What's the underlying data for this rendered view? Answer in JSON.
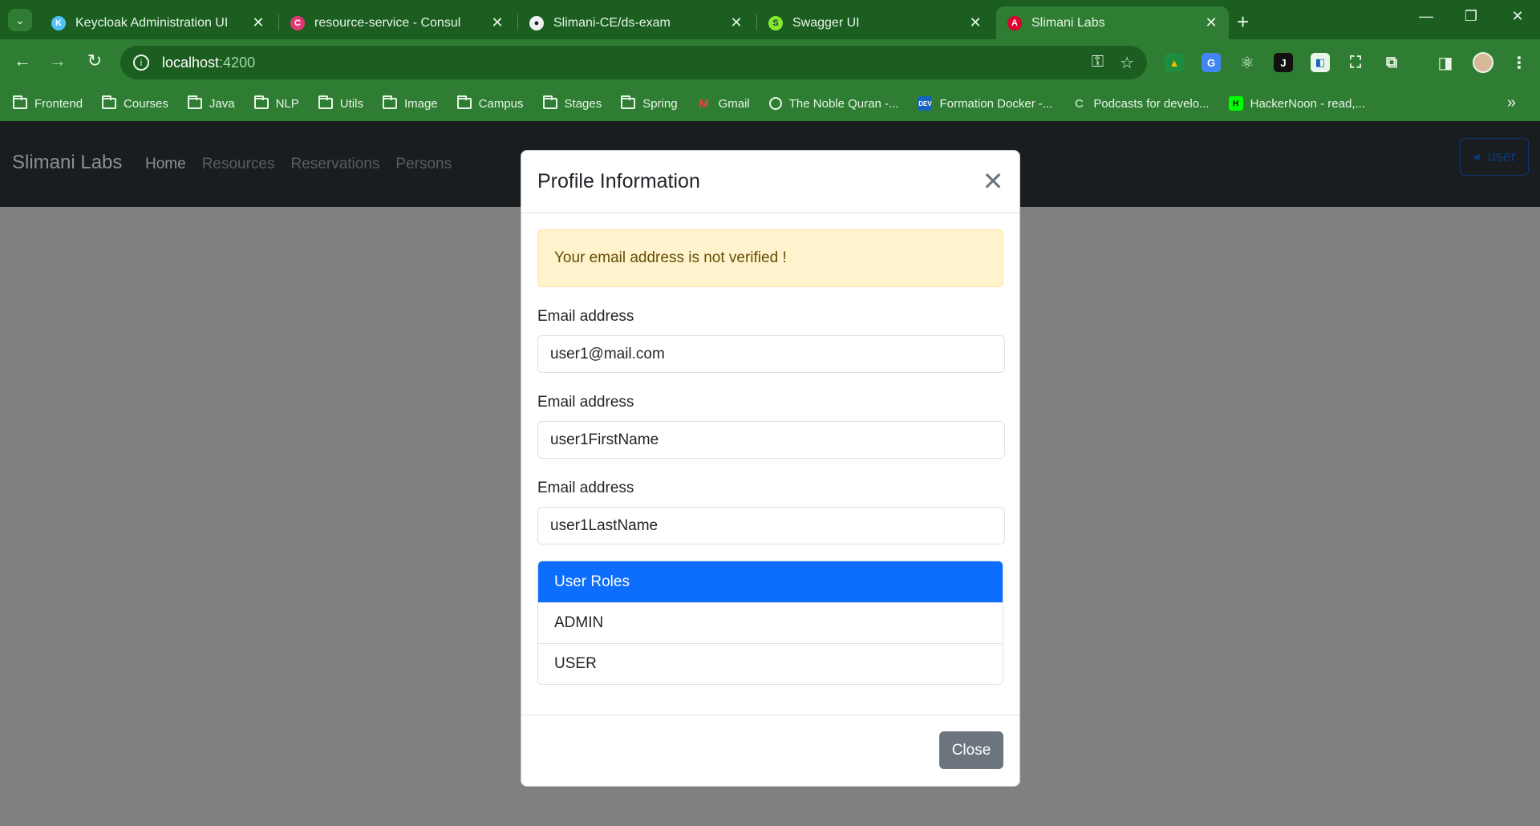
{
  "browser": {
    "tabs": [
      {
        "title": "Keycloak Administration UI",
        "active": false
      },
      {
        "title": "resource-service - Consul",
        "active": false
      },
      {
        "title": "Slimani-CE/ds-exam",
        "active": false
      },
      {
        "title": "Swagger UI",
        "active": false
      },
      {
        "title": "Slimani Labs",
        "active": true
      }
    ],
    "new_tab": "+",
    "window_controls": {
      "minimize": "—",
      "restore": "❐",
      "close": "✕"
    },
    "address": {
      "host": "localhost",
      "port": ":4200"
    },
    "bookmarks": [
      {
        "label": "Frontend",
        "type": "folder"
      },
      {
        "label": "Courses",
        "type": "folder"
      },
      {
        "label": "Java",
        "type": "folder"
      },
      {
        "label": "NLP",
        "type": "folder"
      },
      {
        "label": "Utils",
        "type": "folder"
      },
      {
        "label": "Image",
        "type": "folder"
      },
      {
        "label": "Campus",
        "type": "folder"
      },
      {
        "label": "Stages",
        "type": "folder"
      },
      {
        "label": "Spring",
        "type": "folder"
      },
      {
        "label": "Gmail",
        "type": "site",
        "icon": "gmail-icon"
      },
      {
        "label": "The Noble Quran -...",
        "type": "site",
        "icon": "quran-icon"
      },
      {
        "label": "Formation Docker -...",
        "type": "site",
        "icon": "dev-icon"
      },
      {
        "label": "Podcasts for develo...",
        "type": "site",
        "icon": "podcast-icon"
      },
      {
        "label": "HackerNoon - read,...",
        "type": "site",
        "icon": "hackernoon-icon"
      }
    ]
  },
  "app": {
    "brand": "Slimani Labs",
    "nav": [
      {
        "label": "Home",
        "active": true
      },
      {
        "label": "Resources",
        "active": false
      },
      {
        "label": "Reservations",
        "active": false
      },
      {
        "label": "Persons",
        "active": false
      }
    ],
    "user_button": "user"
  },
  "modal": {
    "title": "Profile Information",
    "alert": "Your email address is not verified !",
    "fields": [
      {
        "label": "Email address",
        "value": "user1@mail.com"
      },
      {
        "label": "Email address",
        "value": "user1FirstName"
      },
      {
        "label": "Email address",
        "value": "user1LastName"
      }
    ],
    "roles_header": "User Roles",
    "roles": [
      "ADMIN",
      "USER"
    ],
    "close_label": "Close"
  },
  "colors": {
    "browser_frame": "#1b5e20",
    "browser_toolbar": "#2e7d32",
    "app_navbar": "#1a1d20",
    "primary": "#0d6efd",
    "alert_bg": "#fff3cd",
    "secondary_btn": "#6c757d"
  }
}
